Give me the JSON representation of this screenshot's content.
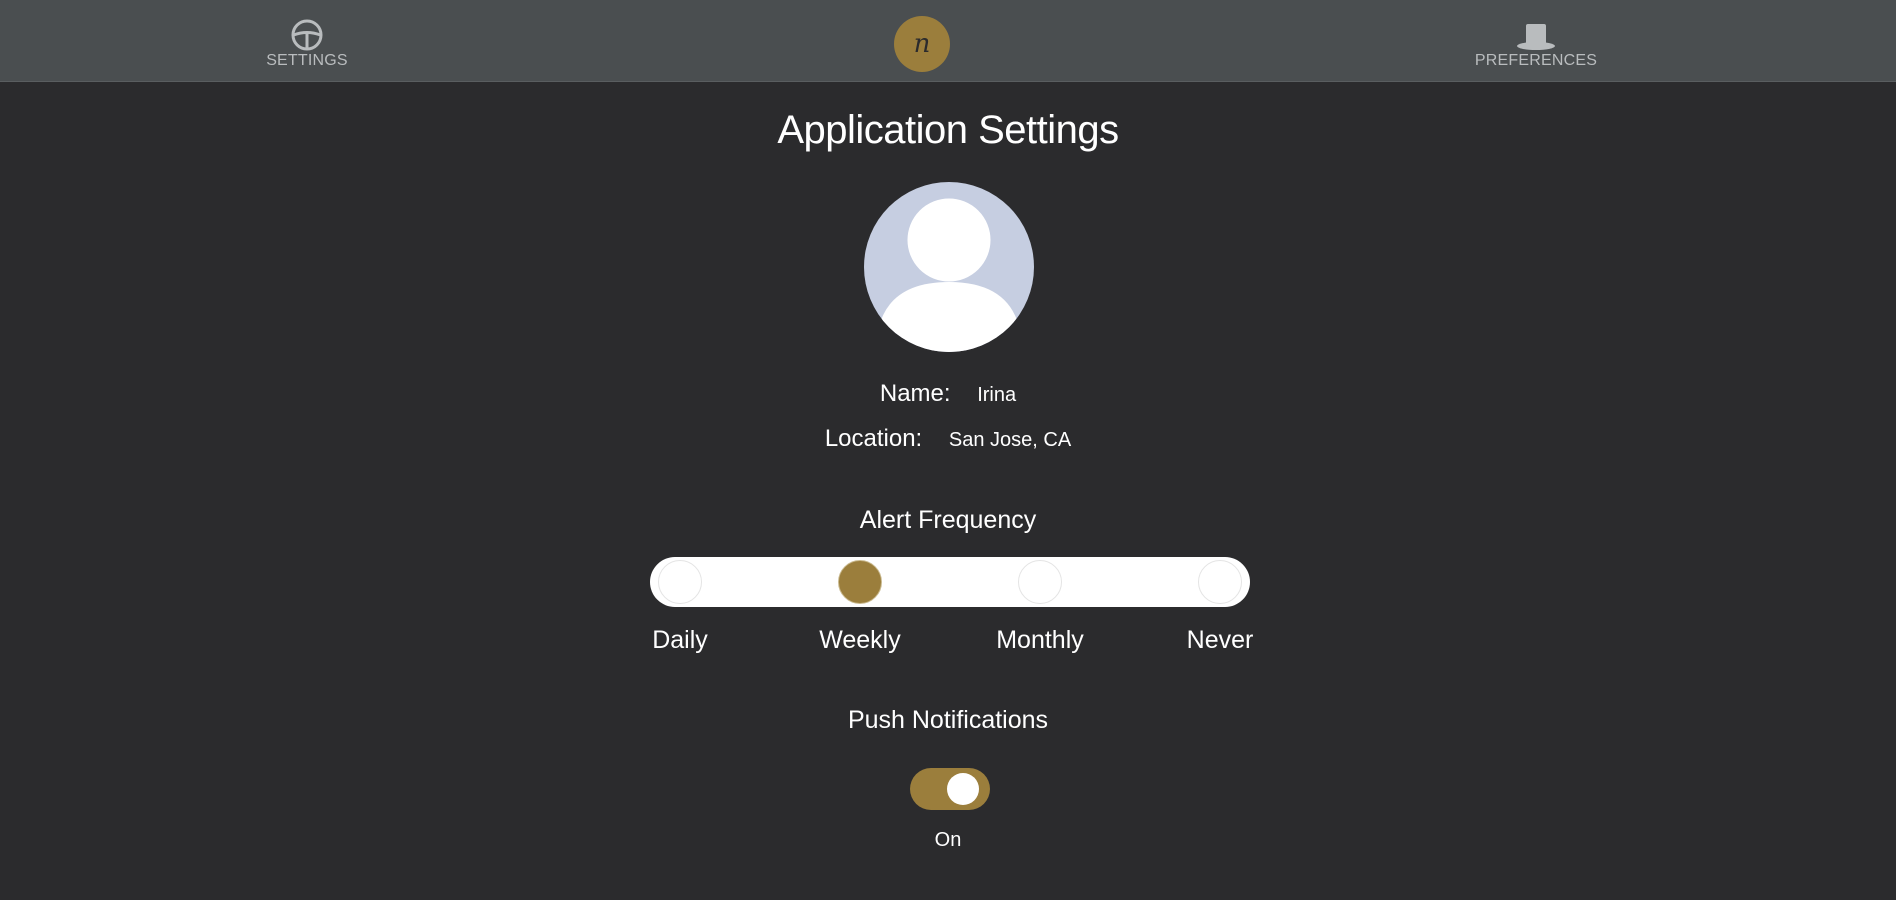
{
  "nav": {
    "left": {
      "label": "SETTINGS",
      "icon": "steering-wheel-icon"
    },
    "center": {
      "logo_letter": "n",
      "icon": "brand-logo"
    },
    "right": {
      "label": "PREFERENCES",
      "icon": "top-hat-icon"
    }
  },
  "page": {
    "title": "Application Settings"
  },
  "profile": {
    "avatar_icon": "user-avatar-icon",
    "name_label": "Name:",
    "name_value": "Irina",
    "location_label": "Location:",
    "location_value": "San Jose, CA"
  },
  "alert_frequency": {
    "title": "Alert Frequency",
    "options": [
      "Daily",
      "Weekly",
      "Monthly",
      "Never"
    ],
    "selected": "Weekly"
  },
  "push_notifications": {
    "title": "Push Notifications",
    "enabled": true,
    "status_label": "On"
  },
  "colors": {
    "background": "#2b2b2d",
    "header": "#4a4e50",
    "accent": "#9b7e3c",
    "avatar_bg": "#c6cee1",
    "nav_text": "#b9bcbe"
  }
}
